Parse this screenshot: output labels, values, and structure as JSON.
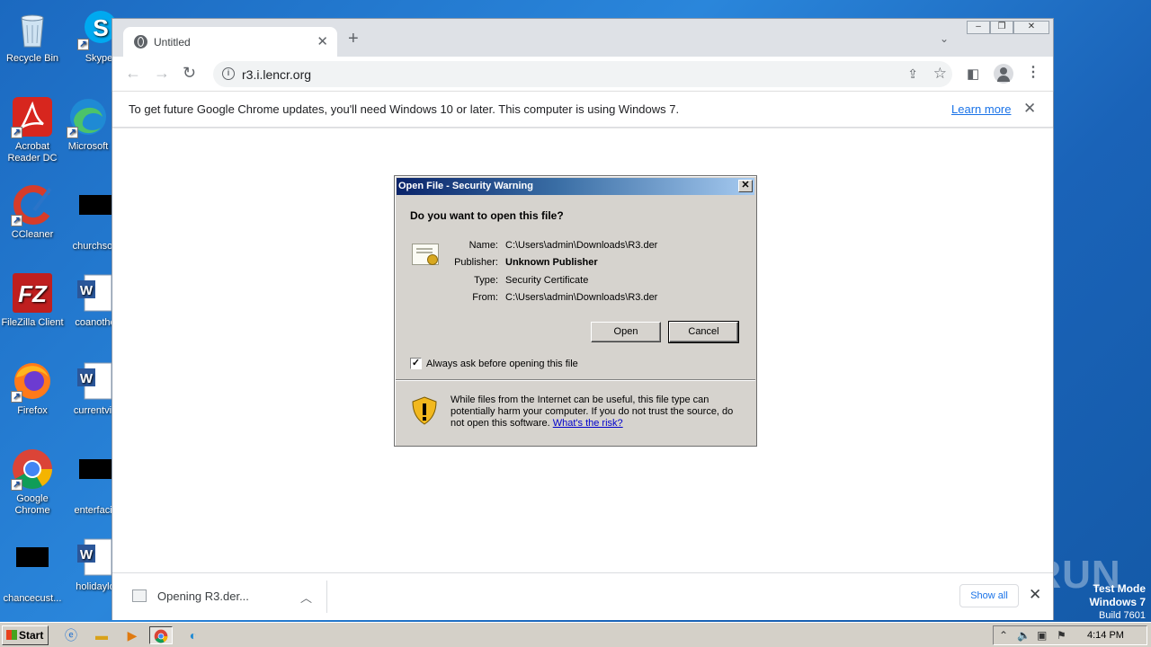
{
  "desktop": {
    "icons": [
      {
        "label": "Recycle Bin",
        "icon": "recycle-bin-icon"
      },
      {
        "label": "Skype",
        "icon": "skype-icon"
      },
      {
        "label": "Acrobat Reader DC",
        "icon": "acrobat-icon"
      },
      {
        "label": "Microsoft",
        "icon": "edge-icon"
      },
      {
        "label": "CCleaner",
        "icon": "ccleaner-icon"
      },
      {
        "label": "churchsou",
        "icon": "black-thumbnail-icon"
      },
      {
        "label": "FileZilla Client",
        "icon": "filezilla-icon"
      },
      {
        "label": "coanothe",
        "icon": "word-doc-icon"
      },
      {
        "label": "Firefox",
        "icon": "firefox-icon"
      },
      {
        "label": "currentvie",
        "icon": "word-doc-icon"
      },
      {
        "label": "Google Chrome",
        "icon": "chrome-icon"
      },
      {
        "label": "enterfacili",
        "icon": "black-thumbnail-icon"
      },
      {
        "label": "chancecust...",
        "icon": "black-thumbnail-icon"
      },
      {
        "label": "holidaylo",
        "icon": "word-doc-icon"
      }
    ],
    "watermark": "ANY RUN",
    "test_mode": {
      "line1": "Test Mode",
      "line2": "Windows 7",
      "line3": "Build 7601"
    }
  },
  "browser": {
    "tab_title": "Untitled",
    "tab_close": "✕",
    "new_tab": "+",
    "url": "r3.i.lencr.org",
    "window_buttons": {
      "minimize": "–",
      "restore": "❐",
      "close": "✕"
    },
    "infobar": {
      "message": "To get future Google Chrome updates, you'll need Windows 10 or later. This computer is using Windows 7.",
      "link": "Learn more",
      "close": "✕"
    },
    "download": {
      "filename": "Opening R3.der...",
      "show_all": "Show all",
      "close": "✕"
    }
  },
  "dialog": {
    "title": "Open File - Security Warning",
    "close": "✕",
    "question": "Do you want to open this file?",
    "fields": [
      {
        "label": "Name:",
        "value": "C:\\Users\\admin\\Downloads\\R3.der",
        "bold": false
      },
      {
        "label": "Publisher:",
        "value": "Unknown Publisher",
        "bold": true
      },
      {
        "label": "Type:",
        "value": "Security Certificate",
        "bold": false
      },
      {
        "label": "From:",
        "value": "C:\\Users\\admin\\Downloads\\R3.der",
        "bold": false
      }
    ],
    "open_label": "Open",
    "cancel_label": "Cancel",
    "checkbox_checked": true,
    "checkbox_mark": "✓",
    "checkbox_label": "Always ask before opening this file",
    "warning_text": "While files from the Internet can be useful, this file type can potentially harm your computer. If you do not trust the source, do not open this software.",
    "risk_link": "What's the risk?"
  },
  "taskbar": {
    "start_label": "Start",
    "apps": [
      "internet-explorer-icon",
      "folder-icon",
      "media-player-icon",
      "chrome-icon",
      "edge-icon"
    ],
    "clock": "4:14 PM"
  }
}
